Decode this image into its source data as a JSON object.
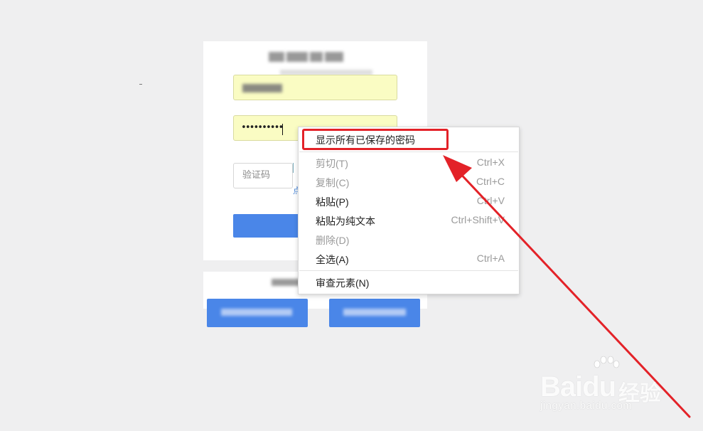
{
  "login": {
    "password_mask": "••••••••••",
    "captcha_placeholder": "验证码",
    "captcha_link_char": "点"
  },
  "context_menu": {
    "items": [
      {
        "label": "显示所有已保存的密码",
        "shortcut": "",
        "enabled": true
      },
      {
        "label": "剪切(T)",
        "shortcut": "Ctrl+X",
        "enabled": false
      },
      {
        "label": "复制(C)",
        "shortcut": "Ctrl+C",
        "enabled": false
      },
      {
        "label": "粘贴(P)",
        "shortcut": "Ctrl+V",
        "enabled": true
      },
      {
        "label": "粘贴为纯文本",
        "shortcut": "Ctrl+Shift+V",
        "enabled": true
      },
      {
        "label": "删除(D)",
        "shortcut": "",
        "enabled": false
      },
      {
        "label": "全选(A)",
        "shortcut": "Ctrl+A",
        "enabled": true
      },
      {
        "label": "审查元素(N)",
        "shortcut": "",
        "enabled": true
      }
    ]
  },
  "annotation": {
    "highlight_color": "#e32228",
    "arrow_color": "#e32228"
  },
  "watermark": {
    "logo": "Baidu",
    "cn": "经验",
    "url": "jingyan.baidu.com"
  },
  "colors": {
    "background": "#efeff0",
    "autofill": "#fafcc3",
    "primary_button": "#4a86e8"
  }
}
